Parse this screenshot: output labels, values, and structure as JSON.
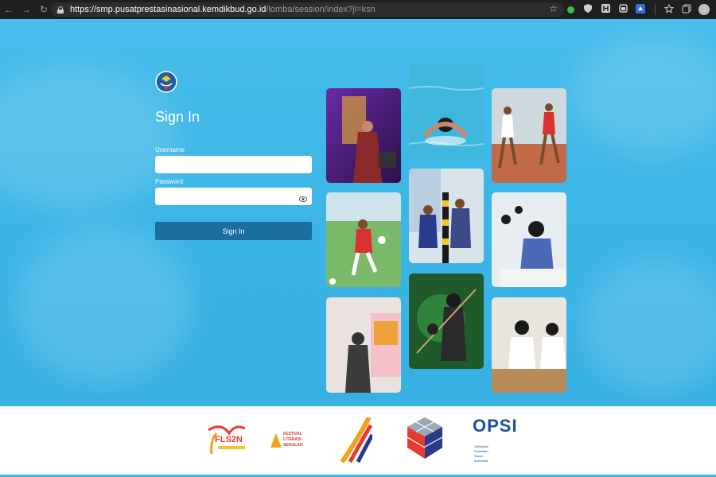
{
  "browser": {
    "url_host": "https://smp.pusatprestasinasional.kemdikbud.go.id",
    "url_path": "/lomba/session/index?jl=ksn",
    "back_glyph": "←",
    "forward_glyph": "→",
    "reload_glyph": "↻",
    "star_glyph": "☆",
    "menu_glyph": "⋯",
    "extensions": [
      {
        "icon": "extension-icon-green",
        "color": "#3cba54"
      },
      {
        "icon": "shield-icon",
        "color": "#d0d0d0"
      },
      {
        "icon": "extension-icon-h",
        "color": "#d0d0d0"
      },
      {
        "icon": "extension-icon-box",
        "color": "#d0d0d0"
      },
      {
        "icon": "extension-icon-blue",
        "color": "#2f6ee5"
      }
    ]
  },
  "login": {
    "title": "Sign In",
    "username_label": "Username",
    "username_value": "",
    "password_label": "Password",
    "password_value": "",
    "submit_label": "Sign In"
  },
  "footer": {
    "logo1_text": "FLS2N",
    "logo2_line1": "FESTIVAL",
    "logo2_line2": "LITERASI",
    "logo2_line3": "SEKOLAH",
    "logo5_text": "OPSI",
    "logo5_sub1": "Olimpiade",
    "logo5_sub2": "Penelitian",
    "logo5_sub3": "Siswa",
    "logo5_sub4": "Indonesia"
  },
  "colors": {
    "page_bg": "#3bb5e6",
    "button": "#1c6e9f",
    "footer_accent": "#3ab4e4"
  }
}
